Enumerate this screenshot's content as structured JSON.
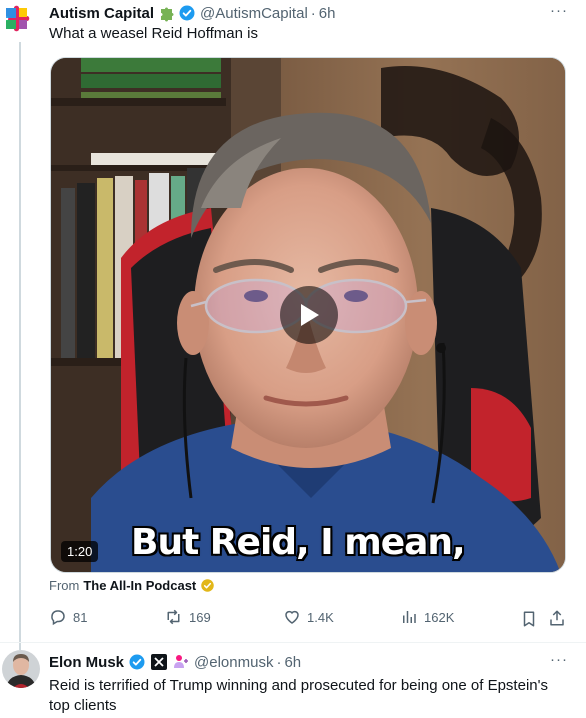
{
  "tweet1": {
    "name": "Autism Capital",
    "handle": "@AutismCapital",
    "time": "6h",
    "text": "What a weasel Reid Hoffman is",
    "video": {
      "duration": "1:20",
      "caption": "But Reid, I mean,"
    },
    "source_prefix": "From",
    "source_name": "The All-In Podcast",
    "replies": "81",
    "reposts": "169",
    "likes": "1.4K",
    "views": "162K"
  },
  "tweet2": {
    "name": "Elon Musk",
    "handle": "@elonmusk",
    "time": "6h",
    "text_line1": "Reid is terrified of Trump winning and prosecuted for being one of Epstein's",
    "text_line2": "top clients"
  },
  "more_label": "···",
  "separator": "·",
  "colors": {
    "verified_blue": "#1d9bf0",
    "gold_badge": "#e2b719",
    "text_secondary": "#536471"
  }
}
